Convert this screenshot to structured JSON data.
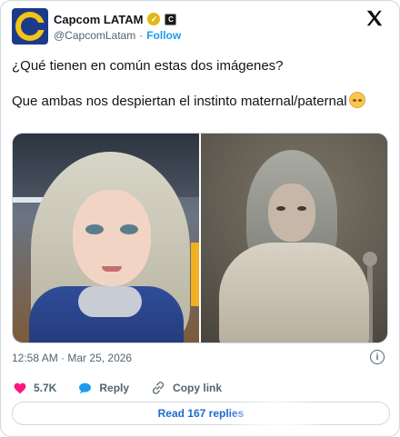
{
  "author": {
    "display_name": "Capcom LATAM",
    "handle": "@CapcomLatam",
    "separator": "·",
    "follow_label": "Follow",
    "verified_badge": "check-badge-gold",
    "affiliate_badge": "C"
  },
  "tweet": {
    "line1": "¿Qué tienen en común estas dos imágenes?",
    "line2": "Que ambas nos despiertan el instinto maternal/paternal"
  },
  "meta": {
    "time": "12:58 AM",
    "separator": "·",
    "date": "Mar 25, 2026"
  },
  "actions": {
    "likes": "5.7K",
    "reply_label": "Reply",
    "copy_label": "Copy link"
  },
  "read_replies_label": "Read 167 replies",
  "colors": {
    "link_blue": "#1d9bf0",
    "heart_pink": "#f91880",
    "gold_badge": "#e2b719"
  },
  "icons": [
    "capcom-logo",
    "verified-icon",
    "affiliate-icon",
    "x-logo-icon",
    "smile-emoji-icon",
    "info-icon",
    "heart-icon",
    "reply-icon",
    "link-icon"
  ]
}
